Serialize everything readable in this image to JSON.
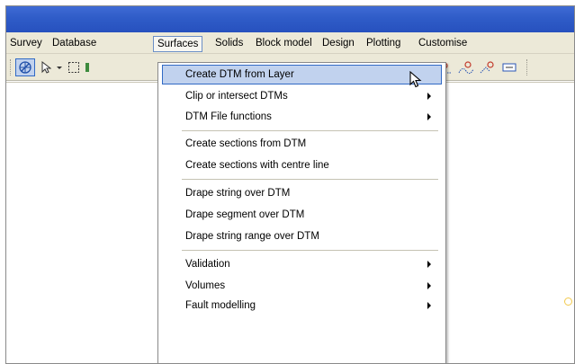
{
  "menubar": {
    "items": [
      {
        "label": "Survey"
      },
      {
        "label": "Database"
      },
      {
        "label": "Surfaces",
        "active": true
      },
      {
        "label": "Solids"
      },
      {
        "label": "Block model"
      },
      {
        "label": "Design"
      },
      {
        "label": "Plotting"
      },
      {
        "label": "Customise"
      }
    ]
  },
  "toolbar": {
    "buttons": [
      {
        "icon": "globe-cursor-icon",
        "pressed": true
      },
      {
        "icon": "pointer-arrow-icon"
      },
      {
        "icon": "dropdown-arrow-icon"
      },
      {
        "icon": "rectangle-select-icon"
      },
      {
        "icon": "snap-point-icon"
      },
      {
        "icon": "point-move-icon"
      },
      {
        "icon": "point-insert-icon"
      },
      {
        "icon": "curve-edit-icon"
      },
      {
        "icon": "text-box-icon"
      }
    ]
  },
  "surfaces_menu": {
    "items": [
      {
        "label": "Create DTM from Layer",
        "highlighted": true,
        "submenu": false
      },
      {
        "label": "Clip or intersect DTMs",
        "submenu": true
      },
      {
        "label": "DTM File functions",
        "submenu": true
      },
      {
        "label": "Create sections from DTM",
        "submenu": false
      },
      {
        "label": "Create sections with centre line",
        "submenu": false
      },
      {
        "label": "Drape string over DTM",
        "submenu": false
      },
      {
        "label": "Drape segment over DTM",
        "submenu": false
      },
      {
        "label": "Drape string range over DTM",
        "submenu": false
      },
      {
        "label": "Validation",
        "submenu": true
      },
      {
        "label": "Volumes",
        "submenu": true
      },
      {
        "label": "Fault modelling",
        "submenu": true
      }
    ]
  },
  "colors": {
    "titlebar": "#2f5cc8",
    "menubar": "#ece9d8",
    "highlight": "#c1d2ee",
    "highlight_border": "#316ac5"
  }
}
